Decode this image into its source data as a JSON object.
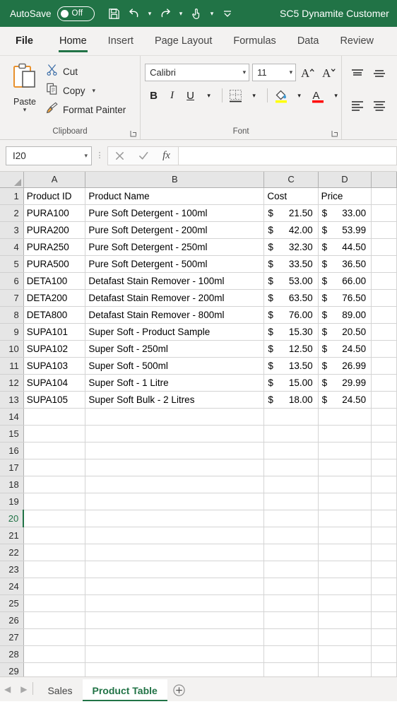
{
  "titlebar": {
    "autosave_label": "AutoSave",
    "autosave_state": "Off",
    "window_title": "SC5 Dynamite Customer",
    "quick_access": [
      {
        "name": "save-icon",
        "label": "Save"
      },
      {
        "name": "undo-icon",
        "label": "Undo"
      },
      {
        "name": "redo-icon",
        "label": "Redo"
      },
      {
        "name": "touch-mouse-mode-icon",
        "label": "Touch/Mouse Mode"
      },
      {
        "name": "customize-quick-access-toolbar-icon",
        "label": "Customize Quick Access Toolbar"
      }
    ],
    "accent_green": "#217346"
  },
  "ribbon_tabs": [
    {
      "label": "File",
      "active": false
    },
    {
      "label": "Home",
      "active": true
    },
    {
      "label": "Insert",
      "active": false
    },
    {
      "label": "Page Layout",
      "active": false
    },
    {
      "label": "Formulas",
      "active": false
    },
    {
      "label": "Data",
      "active": false
    },
    {
      "label": "Review",
      "active": false
    }
  ],
  "ribbon": {
    "clipboard": {
      "group_label": "Clipboard",
      "paste_label": "Paste",
      "cut_label": "Cut",
      "copy_label": "Copy",
      "format_painter_label": "Format Painter"
    },
    "font": {
      "group_label": "Font",
      "font_name": "Calibri",
      "font_size": "11",
      "grow_font_label": "Increase Font Size",
      "shrink_font_label": "Decrease Font Size",
      "bold_label": "B",
      "italic_label": "I",
      "underline_label": "U",
      "borders_label": "Borders",
      "fill_color_label": "Fill Color",
      "fill_color": "#ffff00",
      "font_color_label": "Font Color",
      "font_color": "#ff0000"
    },
    "alignment": {
      "group_label": "Alignment",
      "buttons": [
        "Top Align",
        "Middle Align",
        "Align Left",
        "Center"
      ]
    }
  },
  "formula_bar": {
    "name_box_value": "I20",
    "cancel_label": "Cancel",
    "enter_label": "Enter",
    "fx_label": "fx",
    "formula_value": ""
  },
  "sheet": {
    "columns": [
      "A",
      "B",
      "C",
      "D"
    ],
    "headers": [
      "Product ID",
      "Product Name",
      "Cost",
      "Price"
    ],
    "rows": [
      {
        "num": "1",
        "a": "Product ID",
        "b": "Product Name",
        "c": "Cost",
        "d": "Price",
        "money": false
      },
      {
        "num": "2",
        "a": "PURA100",
        "b": "Pure Soft Detergent - 100ml",
        "c": "21.50",
        "d": "33.00",
        "money": true
      },
      {
        "num": "3",
        "a": "PURA200",
        "b": "Pure Soft Detergent - 200ml",
        "c": "42.00",
        "d": "53.99",
        "money": true
      },
      {
        "num": "4",
        "a": "PURA250",
        "b": "Pure Soft Detergent - 250ml",
        "c": "32.30",
        "d": "44.50",
        "money": true
      },
      {
        "num": "5",
        "a": "PURA500",
        "b": "Pure Soft Detergent - 500ml",
        "c": "33.50",
        "d": "36.50",
        "money": true
      },
      {
        "num": "6",
        "a": "DETA100",
        "b": "Detafast Stain Remover - 100ml",
        "c": "53.00",
        "d": "66.00",
        "money": true
      },
      {
        "num": "7",
        "a": "DETA200",
        "b": "Detafast Stain Remover - 200ml",
        "c": "63.50",
        "d": "76.50",
        "money": true
      },
      {
        "num": "8",
        "a": "DETA800",
        "b": "Detafast Stain Remover - 800ml",
        "c": "76.00",
        "d": "89.00",
        "money": true
      },
      {
        "num": "9",
        "a": "SUPA101",
        "b": "Super Soft - Product Sample",
        "c": "15.30",
        "d": "20.50",
        "money": true
      },
      {
        "num": "10",
        "a": "SUPA102",
        "b": "Super Soft - 250ml",
        "c": "12.50",
        "d": "24.50",
        "money": true
      },
      {
        "num": "11",
        "a": "SUPA103",
        "b": "Super Soft - 500ml",
        "c": "13.50",
        "d": "26.99",
        "money": true
      },
      {
        "num": "12",
        "a": "SUPA104",
        "b": "Super Soft - 1 Litre",
        "c": "15.00",
        "d": "29.99",
        "money": true
      },
      {
        "num": "13",
        "a": "SUPA105",
        "b": "Super Soft Bulk - 2 Litres",
        "c": "18.00",
        "d": "24.50",
        "money": true
      },
      {
        "num": "14",
        "a": "",
        "b": "",
        "c": "",
        "d": "",
        "money": false
      },
      {
        "num": "15",
        "a": "",
        "b": "",
        "c": "",
        "d": "",
        "money": false
      },
      {
        "num": "16",
        "a": "",
        "b": "",
        "c": "",
        "d": "",
        "money": false
      },
      {
        "num": "17",
        "a": "",
        "b": "",
        "c": "",
        "d": "",
        "money": false
      },
      {
        "num": "18",
        "a": "",
        "b": "",
        "c": "",
        "d": "",
        "money": false
      },
      {
        "num": "19",
        "a": "",
        "b": "",
        "c": "",
        "d": "",
        "money": false
      },
      {
        "num": "20",
        "a": "",
        "b": "",
        "c": "",
        "d": "",
        "money": false,
        "selected": true
      },
      {
        "num": "21",
        "a": "",
        "b": "",
        "c": "",
        "d": "",
        "money": false
      },
      {
        "num": "22",
        "a": "",
        "b": "",
        "c": "",
        "d": "",
        "money": false
      },
      {
        "num": "23",
        "a": "",
        "b": "",
        "c": "",
        "d": "",
        "money": false
      },
      {
        "num": "24",
        "a": "",
        "b": "",
        "c": "",
        "d": "",
        "money": false
      },
      {
        "num": "25",
        "a": "",
        "b": "",
        "c": "",
        "d": "",
        "money": false
      },
      {
        "num": "26",
        "a": "",
        "b": "",
        "c": "",
        "d": "",
        "money": false
      },
      {
        "num": "27",
        "a": "",
        "b": "",
        "c": "",
        "d": "",
        "money": false
      },
      {
        "num": "28",
        "a": "",
        "b": "",
        "c": "",
        "d": "",
        "money": false
      },
      {
        "num": "29",
        "a": "",
        "b": "",
        "c": "",
        "d": "",
        "money": false
      }
    ],
    "currency_symbol": "$",
    "selected_cell": "I20"
  },
  "sheet_tabs": {
    "tabs": [
      {
        "label": "Sales",
        "active": false
      },
      {
        "label": "Product Table",
        "active": true
      }
    ],
    "add_sheet_label": "New sheet"
  }
}
